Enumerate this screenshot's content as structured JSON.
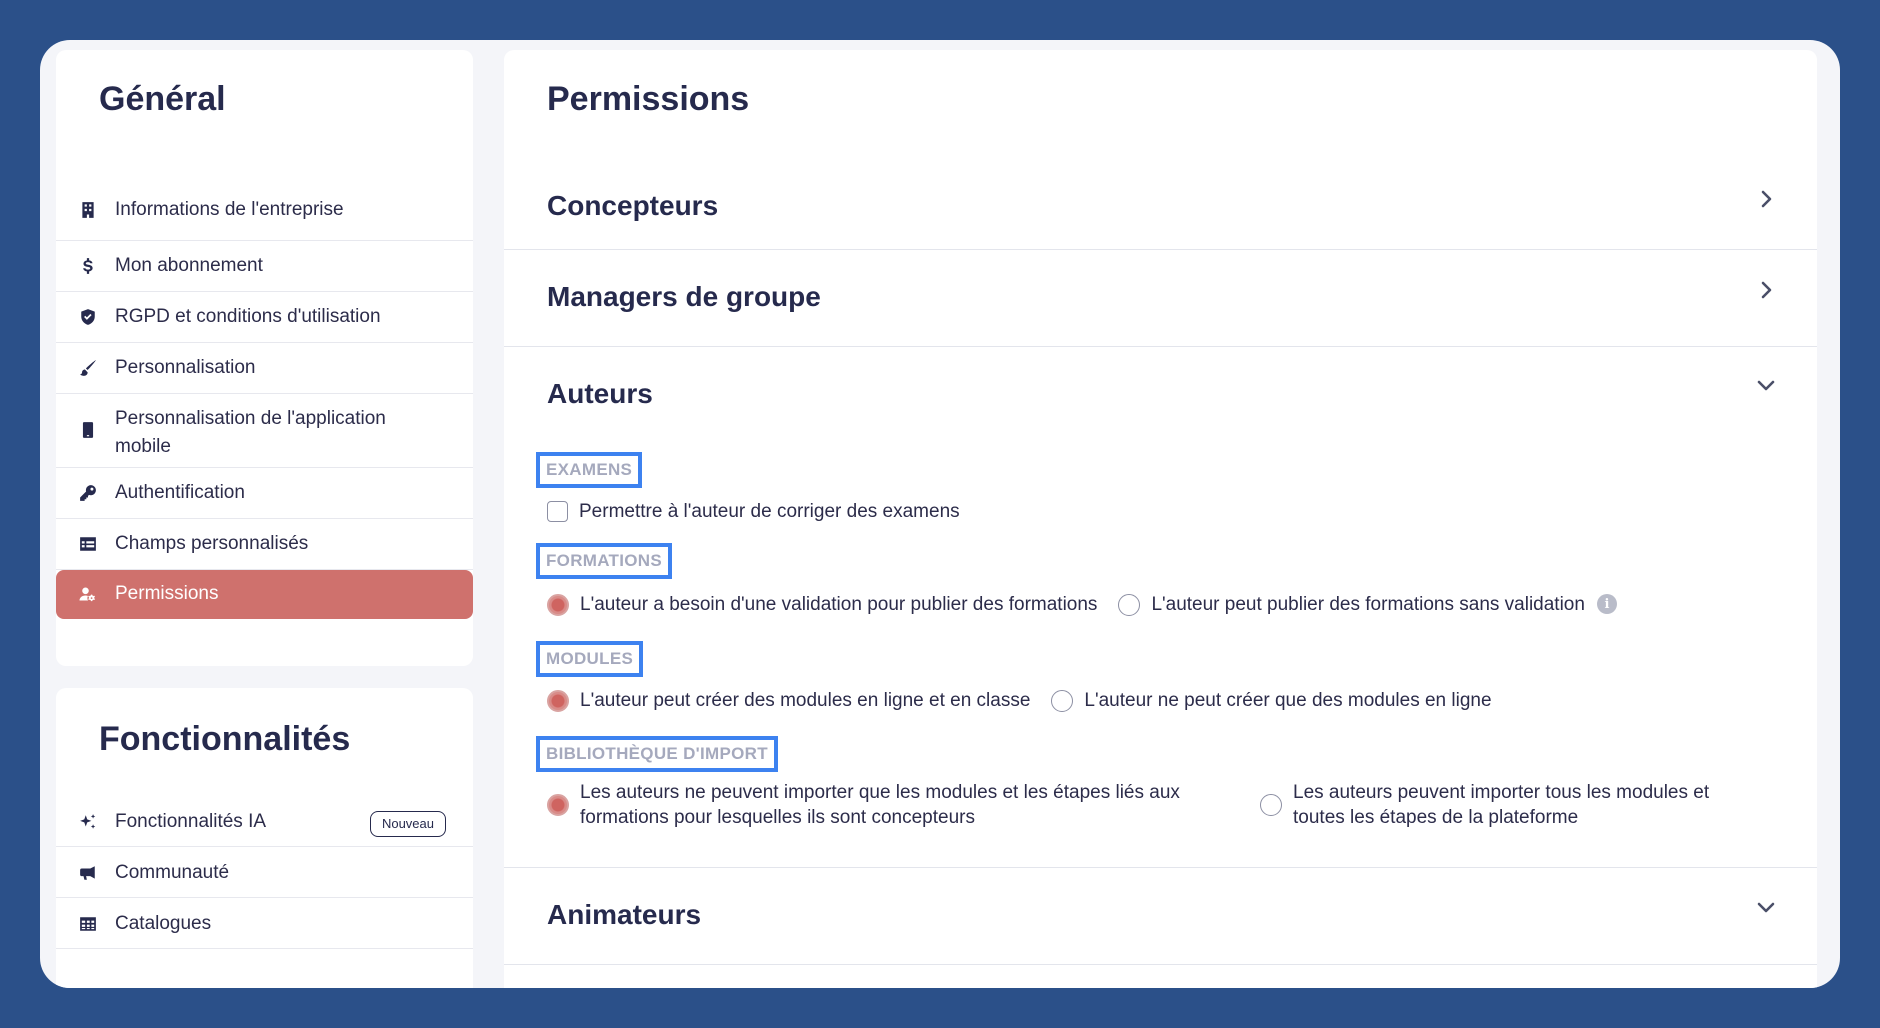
{
  "sidebar": {
    "general_title": "Général",
    "general_items": [
      {
        "label": "Informations de l'entreprise",
        "icon": "building-icon"
      },
      {
        "label": "Mon abonnement",
        "icon": "dollar-icon"
      },
      {
        "label": "RGPD et conditions d'utilisation",
        "icon": "shield-icon"
      },
      {
        "label": "Personnalisation",
        "icon": "brush-icon"
      },
      {
        "label": "Personnalisation de l'application mobile",
        "icon": "mobile-icon"
      },
      {
        "label": "Authentification",
        "icon": "key-icon"
      },
      {
        "label": "Champs personnalisés",
        "icon": "table-icon"
      },
      {
        "label": "Permissions",
        "icon": "user-gear-icon",
        "active": true
      }
    ],
    "features_title": "Fonctionnalités",
    "features_items": [
      {
        "label": "Fonctionnalités IA",
        "icon": "sparkles-icon",
        "badge": "Nouveau"
      },
      {
        "label": "Communauté",
        "icon": "megaphone-icon"
      },
      {
        "label": "Catalogues",
        "icon": "grid-icon"
      }
    ]
  },
  "main": {
    "title": "Permissions",
    "sections": {
      "concepteurs": "Concepteurs",
      "managers": "Managers de groupe",
      "auteurs": "Auteurs",
      "animateurs": "Animateurs"
    },
    "auteurs": {
      "examens": {
        "label": "EXAMENS",
        "checkbox": {
          "label": "Permettre à l'auteur de corriger des examens",
          "checked": false
        }
      },
      "formations": {
        "label": "FORMATIONS",
        "option_1": "L'auteur a besoin d'une validation pour publier des formations",
        "option_2": "L'auteur peut publier des formations sans validation",
        "selected": 1
      },
      "modules": {
        "label": "MODULES",
        "option_1": "L'auteur peut créer des modules en ligne et en classe",
        "option_2": "L'auteur ne peut créer que des modules en ligne",
        "selected": 1
      },
      "bibliotheque": {
        "label": "BIBLIOTHÈQUE D'IMPORT",
        "option_1": "Les auteurs ne peuvent importer que les modules et les étapes liés aux formations pour lesquelles ils sont concepteurs",
        "option_2": "Les auteurs peuvent importer tous les modules et toutes les étapes de la plateforme",
        "selected": 1
      }
    }
  },
  "colors": {
    "background": "#2b5089",
    "active_item": "#cf716d",
    "highlight_box": "#3d82f0",
    "radio_selected": "#cf6460",
    "title_text": "#262a4d"
  }
}
